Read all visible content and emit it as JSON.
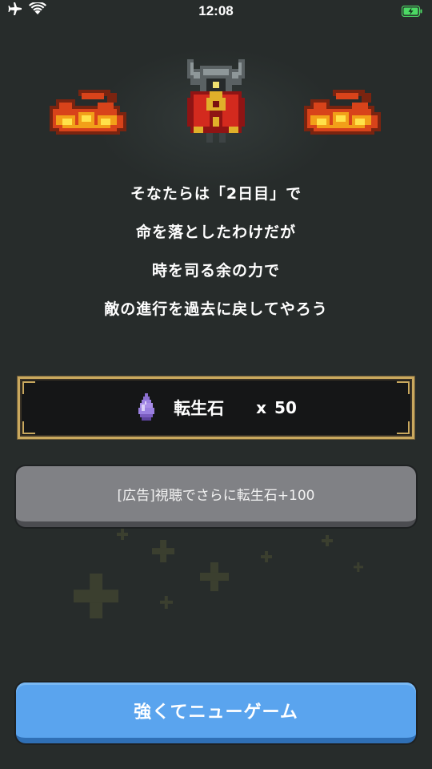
{
  "status_bar": {
    "time": "12:08",
    "icons": [
      "airplane-icon",
      "wifi-icon",
      "battery-charging-icon"
    ]
  },
  "scene": {
    "boss_icon": "time-lord-boss-sprite",
    "flame_icon": "fire-sprite"
  },
  "dialogue": {
    "lines": [
      "そなたらは「2日目」で",
      "命を落としたわけだが",
      "時を司る余の力で",
      "敵の進行を過去に戻してやろう"
    ]
  },
  "reward": {
    "icon": "purple-gem-icon",
    "item_name": "転生石",
    "multiplier": "x",
    "count": "50"
  },
  "ad_button": {
    "label": "[広告]視聴でさらに転生石+100"
  },
  "new_game_button": {
    "label": "強くてニューゲーム"
  },
  "colors": {
    "background": "#272c2b",
    "reward_border": "#c9a85e",
    "ad_button": "#808185",
    "new_game_button": "#5aa4ee",
    "battery": "#4cd964"
  }
}
